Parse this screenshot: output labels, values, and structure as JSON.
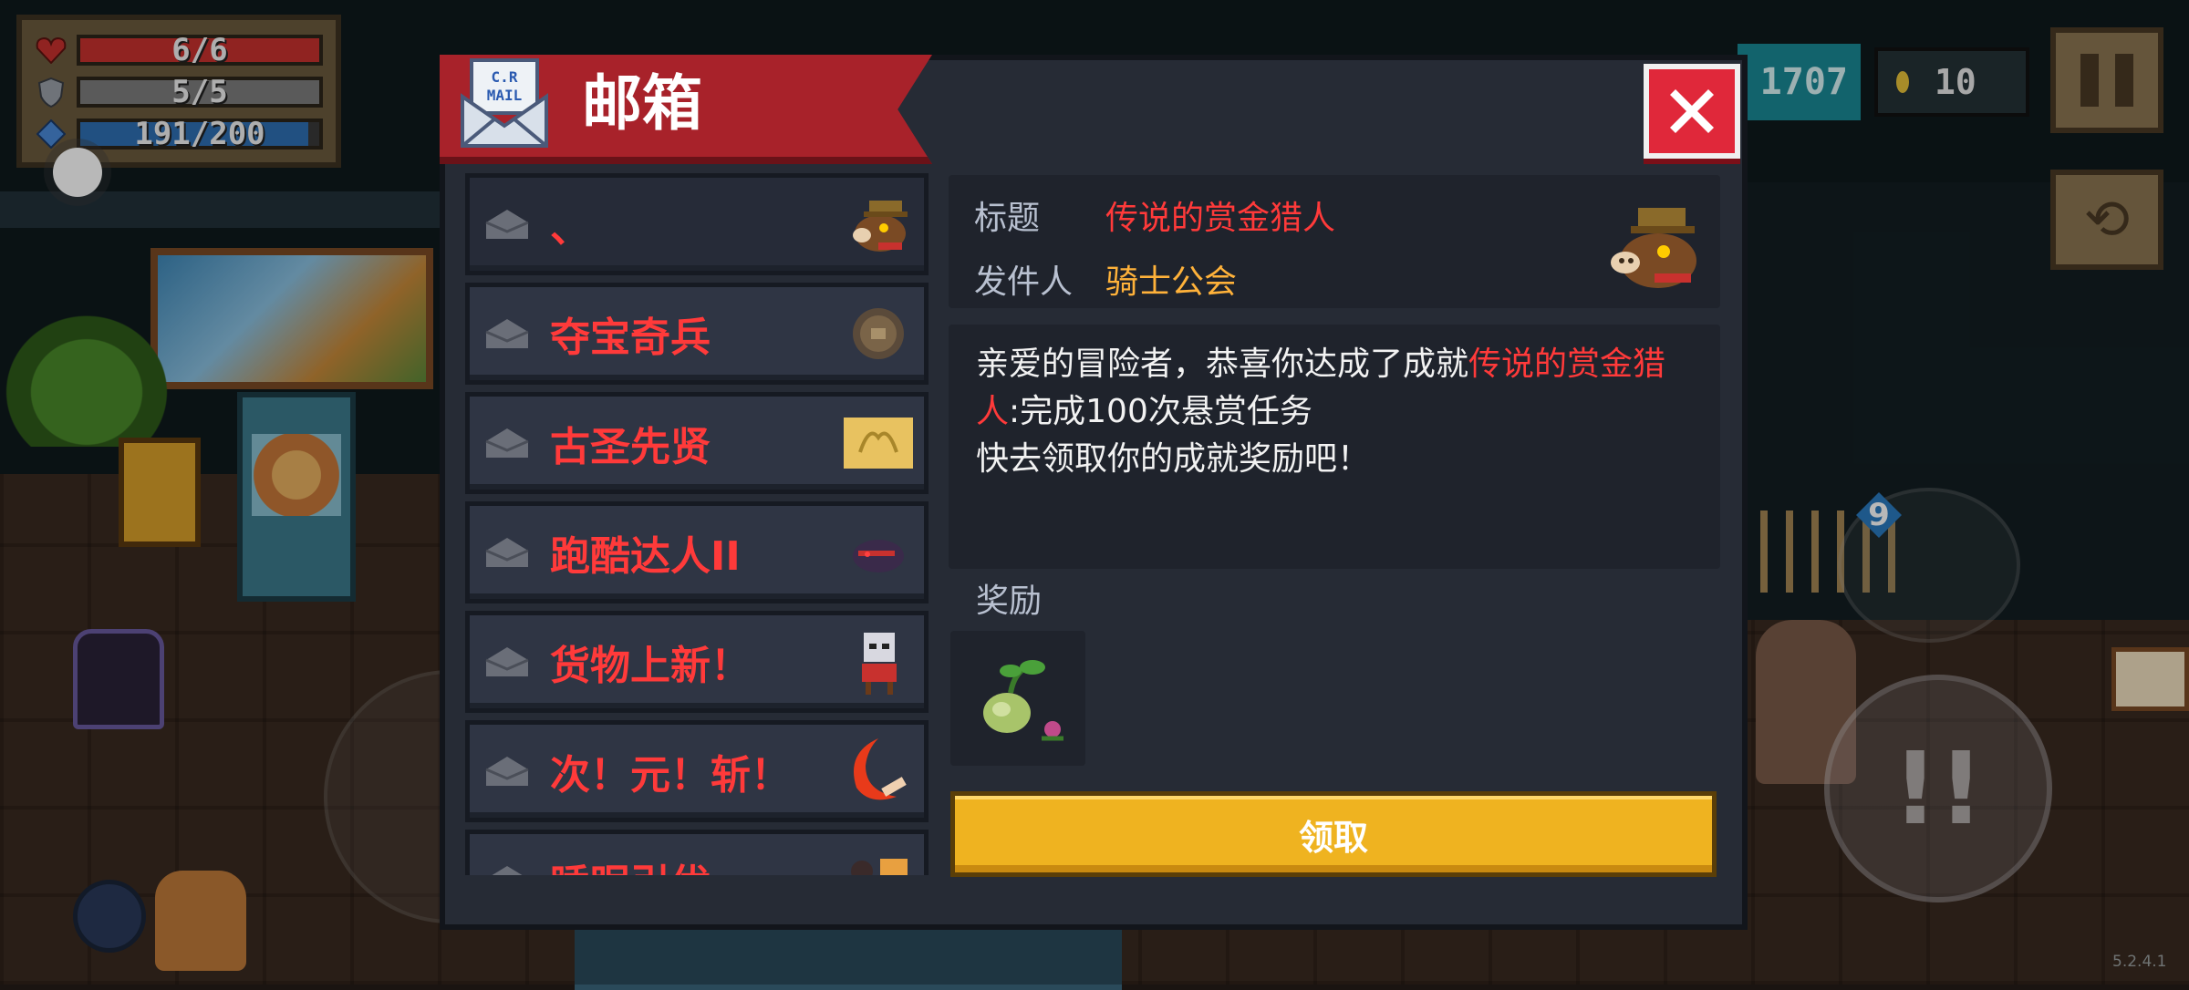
{
  "hud": {
    "health": {
      "text": "6/6",
      "fraction": 1.0,
      "color": "#c8312e"
    },
    "armor": {
      "text": "5/5",
      "fraction": 1.0,
      "color": "#7d7d7d"
    },
    "energy": {
      "text": "191/200",
      "fraction": 0.955,
      "color": "#2f6fb3"
    },
    "gems": "1707",
    "coins": "10",
    "version": "5.2.4.1"
  },
  "mailbox": {
    "title": "邮箱",
    "items": [
      {
        "label": "、",
        "thumb": "boar-bandit-icon"
      },
      {
        "label": "夺宝奇兵",
        "thumb": "treasure-orb-icon"
      },
      {
        "label": "古圣先贤",
        "thumb": "golden-scroll-icon"
      },
      {
        "label": "跑酷达人II",
        "thumb": "shadow-ninja-icon"
      },
      {
        "label": "货物上新！",
        "thumb": "merchant-cat-icon"
      },
      {
        "label": "次！元！斩！",
        "thumb": "crescent-blade-icon"
      },
      {
        "label": "睡眠引优",
        "thumb": "sleepy-characters-icon"
      }
    ],
    "detail": {
      "subject_label": "标题",
      "subject": "传说的赏金猎人",
      "sender_label": "发件人",
      "sender": "骑士公会",
      "body_prefix": "亲爱的冒险者，恭喜你达成了成就",
      "body_highlight": "传说的赏金猎人",
      "body_suffix": ":完成100次悬赏任务",
      "body_line2": "快去领取你的成就奖励吧！",
      "reward_label": "奖励",
      "reward_item": "seed-sprout-icon",
      "claim_label": "领取"
    }
  },
  "colors": {
    "title_banner": "#a8222a",
    "accent_red": "#ff3a3a",
    "sender_orange": "#ffb23a",
    "claim_button": "#efb320",
    "close_button": "#e0283a"
  }
}
